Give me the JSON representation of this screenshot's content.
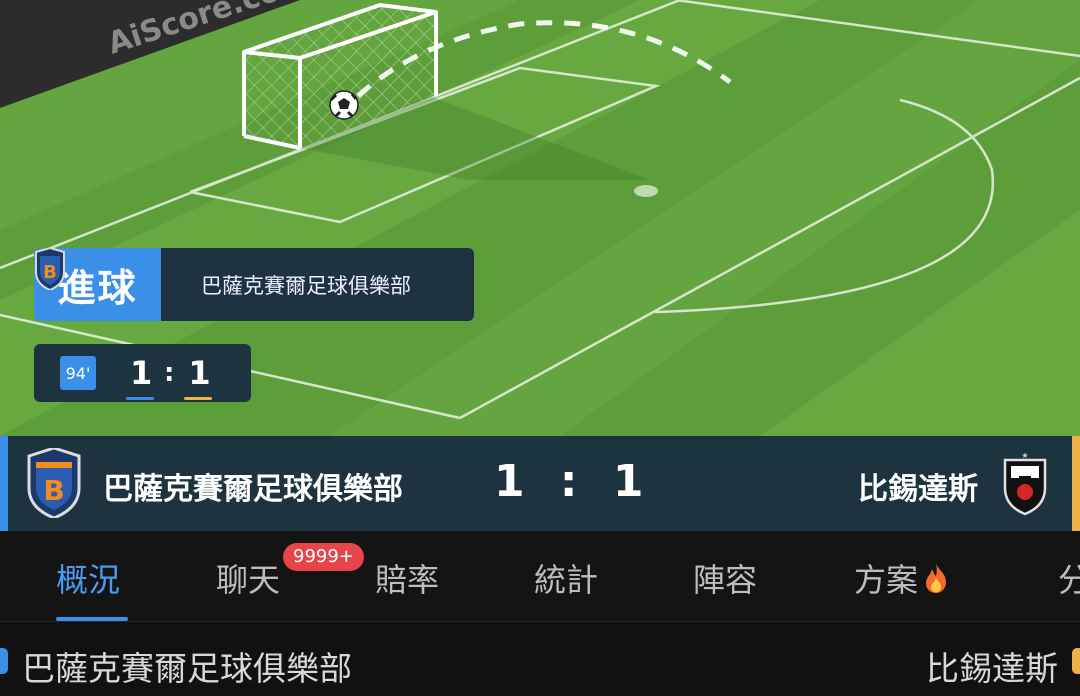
{
  "pitch": {
    "watermark": "AiScore.co"
  },
  "event": {
    "label": "進球",
    "team": "巴薩克賽爾足球俱樂部",
    "minute": "94'",
    "home_score": "1",
    "away_score": "1",
    "separator": ":"
  },
  "match": {
    "home_team": "巴薩克賽爾足球俱樂部",
    "away_team": "比錫達斯",
    "score": "1 : 1",
    "home_color": "#3a8fe8",
    "away_color": "#f0b04a"
  },
  "tabs": [
    {
      "label": "概況",
      "active": true
    },
    {
      "label": "聊天",
      "badge": "9999+"
    },
    {
      "label": "賠率"
    },
    {
      "label": "統計"
    },
    {
      "label": "陣容"
    },
    {
      "label": "方案",
      "icon": "fire-icon"
    },
    {
      "label": "分"
    }
  ],
  "lineup_header": {
    "home": "巴薩克賽爾足球俱樂部",
    "away": "比錫達斯"
  }
}
